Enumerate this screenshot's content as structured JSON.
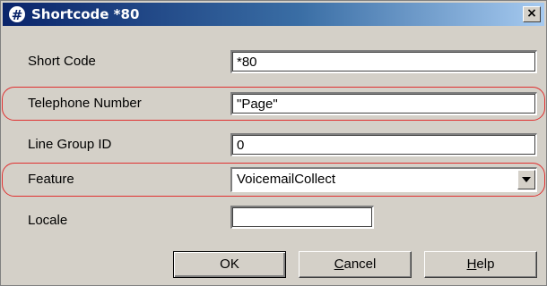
{
  "window": {
    "icon_glyph": "#",
    "icon": "hash-icon",
    "title": "Shortcode *80",
    "close_glyph": "×"
  },
  "fields": {
    "short_code": {
      "label": "Short Code",
      "value": "*80"
    },
    "telephone_number": {
      "label": "Telephone Number",
      "value": "\"Page\""
    },
    "line_group_id": {
      "label": "Line Group ID",
      "value": "0"
    },
    "feature": {
      "label": "Feature",
      "value": "VoicemailCollect"
    },
    "locale": {
      "label": "Locale",
      "value": ""
    }
  },
  "buttons": {
    "ok": "OK",
    "cancel": "Cancel",
    "help": "Help"
  },
  "colors": {
    "dialog_bg": "#d4d0c8",
    "title_start": "#0a246a",
    "title_end": "#a6caf0",
    "highlight": "#e03030"
  }
}
